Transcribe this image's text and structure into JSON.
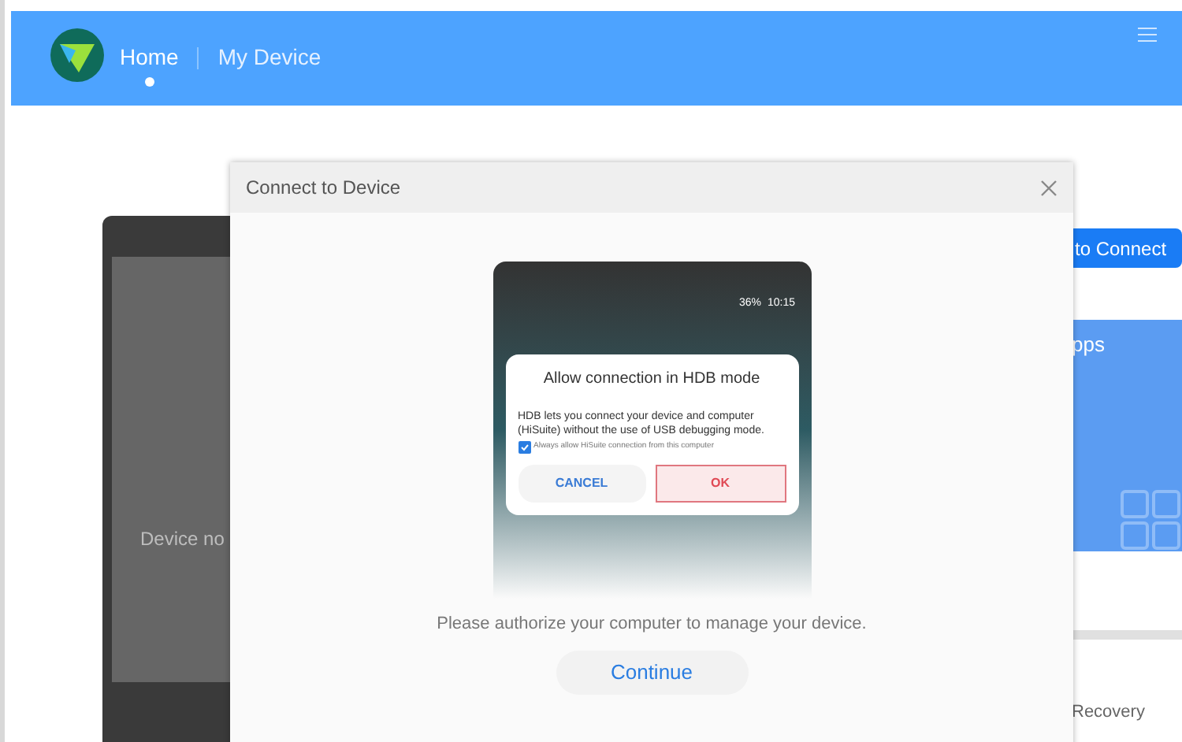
{
  "header": {
    "tabs": [
      {
        "label": "Home",
        "selected": true
      },
      {
        "label": "My Device",
        "selected": false
      }
    ]
  },
  "background": {
    "device_status": "Device no",
    "connect_button": "to Connect",
    "apps_card": {
      "title": "pps"
    },
    "recovery_item": "Recovery"
  },
  "dialog": {
    "title": "Connect to Device",
    "phone": {
      "battery": "36%",
      "time": "10:15",
      "prompt": {
        "title": "Allow connection in HDB mode",
        "body": "HDB lets you connect your device and computer (HiSuite) without the use of USB debugging mode.",
        "checkbox": {
          "label": "Always allow HiSuite connection from this computer",
          "checked": true
        },
        "buttons": [
          {
            "label": "CANCEL",
            "highlighted": false
          },
          {
            "label": "OK",
            "highlighted": true
          }
        ]
      }
    },
    "message": "Please authorize your computer to manage your device.",
    "continue_button": "Continue"
  }
}
